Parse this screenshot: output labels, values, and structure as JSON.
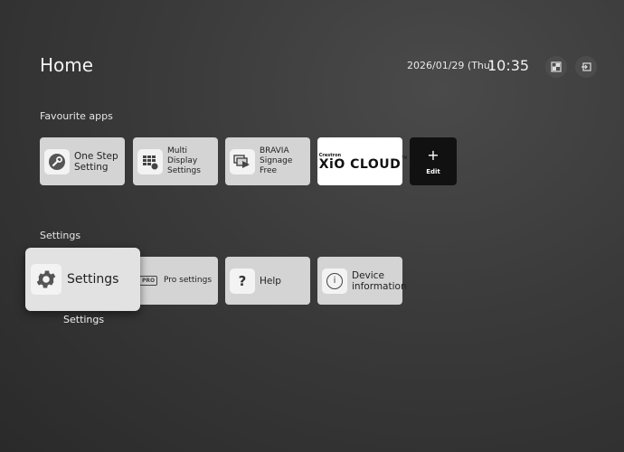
{
  "header": {
    "title": "Home",
    "date": "2026/01/29 (Thu)",
    "time": "10:35",
    "icons": [
      "input-switch-icon",
      "exit-input-icon"
    ]
  },
  "favourites": {
    "label": "Favourite apps",
    "tiles": [
      {
        "line1": "One Step",
        "line2": "Setting",
        "icon": "wrench-icon"
      },
      {
        "line1": "Multi Display",
        "line2": "Settings",
        "icon": "grid-display-icon"
      },
      {
        "line1": "BRAVIA",
        "line2": "Signage Free",
        "icon": "play-screens-icon"
      },
      {
        "brand_small": "Crestron",
        "brand": "XiO CLOUD",
        "tm": "TM"
      },
      {
        "symbol": "+",
        "label": "Edit"
      }
    ]
  },
  "settings": {
    "label": "Settings",
    "focused": {
      "label": "Settings",
      "caption": "Settings",
      "icon": "gear-icon"
    },
    "tiles": [
      {
        "line1": "Pro settings",
        "badge": "PRO",
        "icon": "pro-badge-icon"
      },
      {
        "line1": "Help",
        "symbol": "?",
        "icon": "question-icon"
      },
      {
        "line1": "Device",
        "line2": "information",
        "symbol": "i",
        "icon": "info-icon"
      }
    ]
  },
  "colors": {
    "background": "#3a3a3a",
    "tile": "#d4d4d4",
    "edit_tile": "#111111"
  }
}
